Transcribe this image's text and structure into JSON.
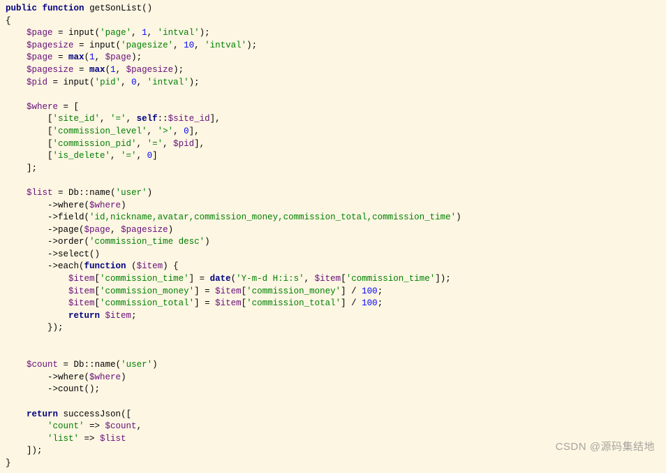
{
  "watermark": "CSDN @源码集结地",
  "code": {
    "l01": {
      "kw1": "public",
      "kw2": "function",
      "name": "getSonList",
      "paren": "()"
    },
    "l02": "{",
    "l03": {
      "indent": "    ",
      "var": "$page",
      "eq": " = ",
      "fn": "input",
      "open": "(",
      "s1": "'page'",
      "c1": ", ",
      "n1": "1",
      "c2": ", ",
      "s2": "'intval'",
      "close": ");"
    },
    "l04": {
      "indent": "    ",
      "var": "$pagesize",
      "eq": " = ",
      "fn": "input",
      "open": "(",
      "s1": "'pagesize'",
      "c1": ", ",
      "n1": "10",
      "c2": ", ",
      "s2": "'intval'",
      "close": ");"
    },
    "l05": {
      "indent": "    ",
      "var": "$page",
      "eq": " = ",
      "fn": "max",
      "open": "(",
      "n1": "1",
      "c1": ", ",
      "v2": "$page",
      "close": ");"
    },
    "l06": {
      "indent": "    ",
      "var": "$pagesize",
      "eq": " = ",
      "fn": "max",
      "open": "(",
      "n1": "1",
      "c1": ", ",
      "v2": "$pagesize",
      "close": ");"
    },
    "l07": {
      "indent": "    ",
      "var": "$pid",
      "eq": " = ",
      "fn": "input",
      "open": "(",
      "s1": "'pid'",
      "c1": ", ",
      "n1": "0",
      "c2": ", ",
      "s2": "'intval'",
      "close": ");"
    },
    "l08": "",
    "l09": {
      "indent": "    ",
      "var": "$where",
      "eq": " = ["
    },
    "l10": {
      "indent": "        [",
      "s1": "'site_id'",
      "c1": ", ",
      "s2": "'='",
      "c2": ", ",
      "self": "self",
      "dbl": "::",
      "prop": "$site_id",
      "close": "],"
    },
    "l11": {
      "indent": "        [",
      "s1": "'commission_level'",
      "c1": ", ",
      "s2": "'>'",
      "c2": ", ",
      "n1": "0",
      "close": "],"
    },
    "l12": {
      "indent": "        [",
      "s1": "'commission_pid'",
      "c1": ", ",
      "s2": "'='",
      "c2": ", ",
      "v1": "$pid",
      "close": "],"
    },
    "l13": {
      "indent": "        [",
      "s1": "'is_delete'",
      "c1": ", ",
      "s2": "'='",
      "c2": ", ",
      "n1": "0",
      "close": "]"
    },
    "l14": {
      "indent": "    ];"
    },
    "l15": "",
    "l16": {
      "indent": "    ",
      "var": "$list",
      "eq": " = ",
      "cls": "Db",
      "dbl": "::",
      "fn": "name",
      "open": "(",
      "s1": "'user'",
      "close": ")"
    },
    "l17": {
      "indent": "        ->",
      "fn": "where",
      "open": "(",
      "v1": "$where",
      "close": ")"
    },
    "l18": {
      "indent": "        ->",
      "fn": "field",
      "open": "(",
      "s1": "'id,nickname,avatar,commission_money,commission_total,commission_time'",
      "close": ")"
    },
    "l19": {
      "indent": "        ->",
      "fn": "page",
      "open": "(",
      "v1": "$page",
      "c1": ", ",
      "v2": "$pagesize",
      "close": ")"
    },
    "l20": {
      "indent": "        ->",
      "fn": "order",
      "open": "(",
      "s1": "'commission_time desc'",
      "close": ")"
    },
    "l21": {
      "indent": "        ->",
      "fn": "select",
      "open": "()",
      "close": ""
    },
    "l22": {
      "indent": "        ->",
      "fn": "each",
      "open": "(",
      "kw": "function",
      "sp": " (",
      "v1": "$item",
      "close": ") {"
    },
    "l23": {
      "indent": "            ",
      "v1": "$item",
      "open": "[",
      "s1": "'commission_time'",
      "close": "] = ",
      "fn": "date",
      "p": "(",
      "s2": "'Y-m-d H:i:s'",
      "c1": ", ",
      "v2": "$item",
      "o2": "[",
      "s3": "'commission_time'",
      "end": "]);"
    },
    "l24": {
      "indent": "            ",
      "v1": "$item",
      "open": "[",
      "s1": "'commission_money'",
      "close": "] = ",
      "v2": "$item",
      "o2": "[",
      "s2": "'commission_money'",
      "mid": "] / ",
      "n1": "100",
      "end": ";"
    },
    "l25": {
      "indent": "            ",
      "v1": "$item",
      "open": "[",
      "s1": "'commission_total'",
      "close": "] = ",
      "v2": "$item",
      "o2": "[",
      "s2": "'commission_total'",
      "mid": "] / ",
      "n1": "100",
      "end": ";"
    },
    "l26": {
      "indent": "            ",
      "kw": "return",
      "sp": " ",
      "v1": "$item",
      "end": ";"
    },
    "l27": {
      "indent": "        });"
    },
    "l28": "",
    "l29": "",
    "l30": {
      "indent": "    ",
      "var": "$count",
      "eq": " = ",
      "cls": "Db",
      "dbl": "::",
      "fn": "name",
      "open": "(",
      "s1": "'user'",
      "close": ")"
    },
    "l31": {
      "indent": "        ->",
      "fn": "where",
      "open": "(",
      "v1": "$where",
      "close": ")"
    },
    "l32": {
      "indent": "        ->",
      "fn": "count",
      "open": "();",
      "close": ""
    },
    "l33": "",
    "l34": {
      "indent": "    ",
      "kw": "return",
      "sp": " ",
      "fn": "successJson",
      "open": "(["
    },
    "l35": {
      "indent": "        ",
      "s1": "'count'",
      "arrow": " => ",
      "v1": "$count",
      "end": ","
    },
    "l36": {
      "indent": "        ",
      "s1": "'list'",
      "arrow": " => ",
      "v1": "$list",
      "end": ""
    },
    "l37": {
      "indent": "    ]);"
    },
    "l38": "}"
  }
}
